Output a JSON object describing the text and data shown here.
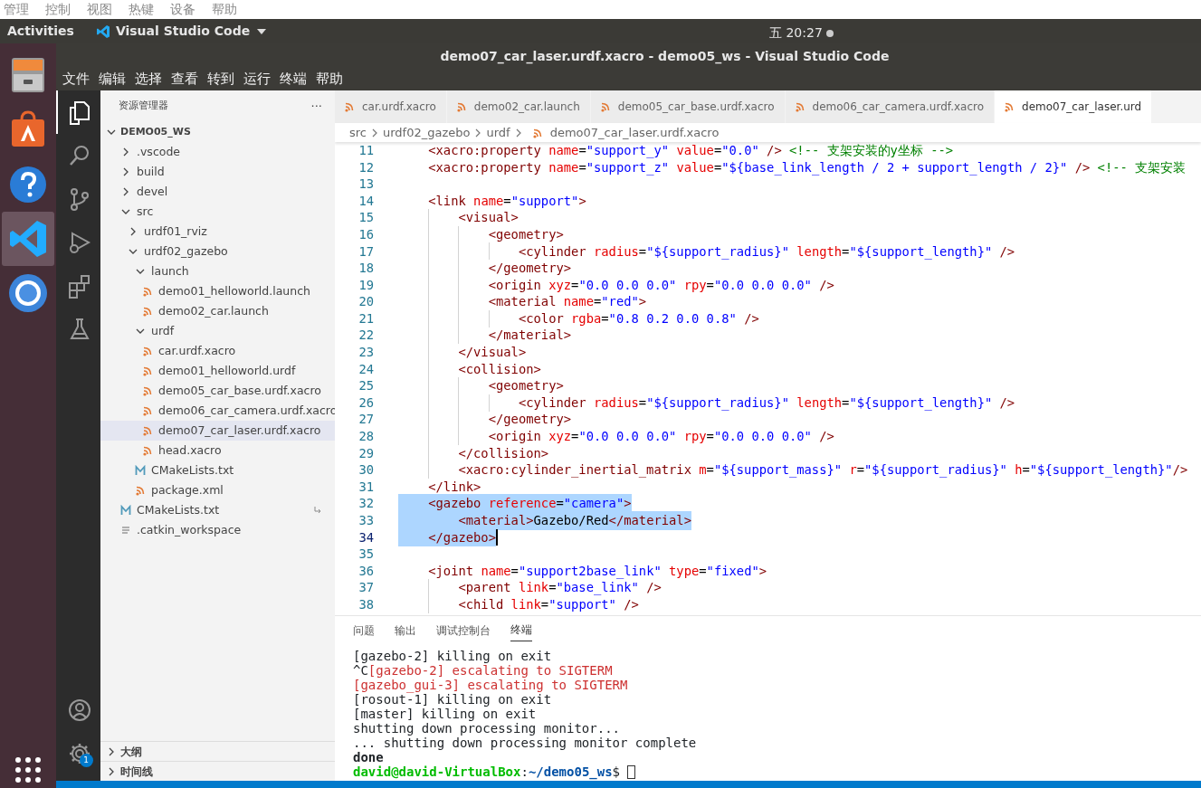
{
  "vm_menu": [
    "管理",
    "控制",
    "视图",
    "热键",
    "设备",
    "帮助"
  ],
  "top_bar": {
    "activities": "Activities",
    "app": "Visual Studio Code",
    "clock": "五 20:27"
  },
  "dock": [
    {
      "kind": "files",
      "selected": false
    },
    {
      "kind": "store",
      "selected": false
    },
    {
      "kind": "help",
      "selected": false
    },
    {
      "kind": "vscode",
      "selected": true
    },
    {
      "kind": "browser",
      "selected": false
    }
  ],
  "window": {
    "title": "demo07_car_laser.urdf.xacro - demo05_ws - Visual Studio Code"
  },
  "menu": [
    "文件",
    "编辑",
    "选择",
    "查看",
    "转到",
    "运行",
    "终端",
    "帮助"
  ],
  "activity_bar": [
    {
      "kind": "explorer",
      "selected": true
    },
    {
      "kind": "search",
      "selected": false
    },
    {
      "kind": "scm",
      "selected": false
    },
    {
      "kind": "debug",
      "selected": false
    },
    {
      "kind": "extensions",
      "selected": false
    },
    {
      "kind": "test",
      "selected": false
    }
  ],
  "activity_bottom": {
    "settings_badge": "1"
  },
  "sidebar": {
    "title": "资源管理器",
    "more": "···",
    "workspace": "DEMO05_WS",
    "tree": [
      {
        "label": ".vscode",
        "kind": "folder",
        "expanded": false
      },
      {
        "label": "build",
        "kind": "folder",
        "expanded": false
      },
      {
        "label": "devel",
        "kind": "folder",
        "expanded": false
      },
      {
        "label": "src",
        "kind": "folder",
        "expanded": true,
        "children": [
          {
            "label": "urdf01_rviz",
            "kind": "folder",
            "expanded": false
          },
          {
            "label": "urdf02_gazebo",
            "kind": "folder",
            "expanded": true,
            "children": [
              {
                "label": "launch",
                "kind": "folder",
                "expanded": true,
                "children": [
                  {
                    "label": "demo01_helloworld.launch",
                    "kind": "xml",
                    "selected": false
                  },
                  {
                    "label": "demo02_car.launch",
                    "kind": "xml",
                    "selected": false
                  }
                ]
              },
              {
                "label": "urdf",
                "kind": "folder",
                "expanded": true,
                "children": [
                  {
                    "label": "car.urdf.xacro",
                    "kind": "xml",
                    "selected": false
                  },
                  {
                    "label": "demo01_helloworld.urdf",
                    "kind": "xml",
                    "selected": false
                  },
                  {
                    "label": "demo05_car_base.urdf.xacro",
                    "kind": "xml",
                    "selected": false
                  },
                  {
                    "label": "demo06_car_camera.urdf.xacro",
                    "kind": "xml",
                    "selected": false
                  },
                  {
                    "label": "demo07_car_laser.urdf.xacro",
                    "kind": "xml",
                    "selected": true
                  },
                  {
                    "label": "head.xacro",
                    "kind": "xml",
                    "selected": false
                  }
                ]
              },
              {
                "label": "CMakeLists.txt",
                "kind": "cmake",
                "selected": false
              },
              {
                "label": "package.xml",
                "kind": "xml",
                "selected": false
              }
            ]
          }
        ]
      },
      {
        "label": "CMakeLists.txt",
        "kind": "cmake",
        "selected": false,
        "symlink": true
      },
      {
        "label": ".catkin_workspace",
        "kind": "file",
        "selected": false
      }
    ],
    "sections": [
      {
        "label": "大纲",
        "expanded": false
      },
      {
        "label": "时间线",
        "expanded": false
      }
    ]
  },
  "tabs": [
    {
      "label": "car.urdf.xacro",
      "selected": false
    },
    {
      "label": "demo02_car.launch",
      "selected": false
    },
    {
      "label": "demo05_car_base.urdf.xacro",
      "selected": false
    },
    {
      "label": "demo06_car_camera.urdf.xacro",
      "selected": false
    },
    {
      "label": "demo07_car_laser.urd",
      "selected": true
    }
  ],
  "breadcrumb": [
    "src",
    "urdf02_gazebo",
    "urdf",
    "demo07_car_laser.urdf.xacro"
  ],
  "code": [
    {
      "number": "11",
      "selected": false,
      "tokens": [
        {
          "kind": "tag",
          "text": "    <xacro:property "
        },
        {
          "kind": "attr",
          "text": "name"
        },
        {
          "kind": "plain",
          "text": "="
        },
        {
          "kind": "string",
          "text": "\"support_y\" "
        },
        {
          "kind": "attr",
          "text": "value"
        },
        {
          "kind": "plain",
          "text": "="
        },
        {
          "kind": "string",
          "text": "\"0.0\""
        },
        {
          "kind": "tag",
          "text": " /> "
        },
        {
          "kind": "comment",
          "text": "<!-- 支架安装的y坐标 -->"
        }
      ]
    },
    {
      "number": "12",
      "selected": false,
      "tokens": [
        {
          "kind": "tag",
          "text": "    <xacro:property "
        },
        {
          "kind": "attr",
          "text": "name"
        },
        {
          "kind": "plain",
          "text": "="
        },
        {
          "kind": "string",
          "text": "\"support_z\" "
        },
        {
          "kind": "attr",
          "text": "value"
        },
        {
          "kind": "plain",
          "text": "="
        },
        {
          "kind": "string",
          "text": "\"${base_link_length / 2 + support_length / 2}\""
        },
        {
          "kind": "tag",
          "text": " /> "
        },
        {
          "kind": "comment",
          "text": "<!-- 支架安装"
        }
      ]
    },
    {
      "number": "13"
    },
    {
      "number": "14",
      "selected": false,
      "tokens": [
        {
          "kind": "tag",
          "text": "    <link "
        },
        {
          "kind": "attr",
          "text": "name"
        },
        {
          "kind": "plain",
          "text": "="
        },
        {
          "kind": "string",
          "text": "\"support\""
        },
        {
          "kind": "tag",
          "text": ">"
        }
      ]
    },
    {
      "number": "15",
      "selected": false,
      "tokens": [
        {
          "kind": "tag",
          "text": "        <visual>"
        }
      ]
    },
    {
      "number": "16",
      "selected": false,
      "tokens": [
        {
          "kind": "tag",
          "text": "            <geometry>"
        }
      ]
    },
    {
      "number": "17",
      "selected": false,
      "tokens": [
        {
          "kind": "tag",
          "text": "                <cylinder "
        },
        {
          "kind": "attr",
          "text": "radius"
        },
        {
          "kind": "plain",
          "text": "="
        },
        {
          "kind": "string",
          "text": "\"${support_radius}\" "
        },
        {
          "kind": "attr",
          "text": "length"
        },
        {
          "kind": "plain",
          "text": "="
        },
        {
          "kind": "string",
          "text": "\"${support_length}\""
        },
        {
          "kind": "tag",
          "text": " />"
        }
      ]
    },
    {
      "number": "18",
      "selected": false,
      "tokens": [
        {
          "kind": "tag",
          "text": "            </geometry>"
        }
      ]
    },
    {
      "number": "19",
      "selected": false,
      "tokens": [
        {
          "kind": "tag",
          "text": "            <origin "
        },
        {
          "kind": "attr",
          "text": "xyz"
        },
        {
          "kind": "plain",
          "text": "="
        },
        {
          "kind": "string",
          "text": "\"0.0 0.0 0.0\" "
        },
        {
          "kind": "attr",
          "text": "rpy"
        },
        {
          "kind": "plain",
          "text": "="
        },
        {
          "kind": "string",
          "text": "\"0.0 0.0 0.0\""
        },
        {
          "kind": "tag",
          "text": " />"
        }
      ]
    },
    {
      "number": "20",
      "selected": false,
      "tokens": [
        {
          "kind": "tag",
          "text": "            <material "
        },
        {
          "kind": "attr",
          "text": "name"
        },
        {
          "kind": "plain",
          "text": "="
        },
        {
          "kind": "string",
          "text": "\"red\""
        },
        {
          "kind": "tag",
          "text": ">"
        }
      ]
    },
    {
      "number": "21",
      "selected": false,
      "tokens": [
        {
          "kind": "tag",
          "text": "                <color "
        },
        {
          "kind": "attr",
          "text": "rgba"
        },
        {
          "kind": "plain",
          "text": "="
        },
        {
          "kind": "string",
          "text": "\"0.8 0.2 0.0 0.8\""
        },
        {
          "kind": "tag",
          "text": " />"
        }
      ]
    },
    {
      "number": "22",
      "selected": false,
      "tokens": [
        {
          "kind": "tag",
          "text": "            </material>"
        }
      ]
    },
    {
      "number": "23",
      "selected": false,
      "tokens": [
        {
          "kind": "tag",
          "text": "        </visual>"
        }
      ]
    },
    {
      "number": "24",
      "selected": false,
      "tokens": [
        {
          "kind": "tag",
          "text": "        <collision>"
        }
      ]
    },
    {
      "number": "25",
      "selected": false,
      "tokens": [
        {
          "kind": "tag",
          "text": "            <geometry>"
        }
      ]
    },
    {
      "number": "26",
      "selected": false,
      "tokens": [
        {
          "kind": "tag",
          "text": "                <cylinder "
        },
        {
          "kind": "attr",
          "text": "radius"
        },
        {
          "kind": "plain",
          "text": "="
        },
        {
          "kind": "string",
          "text": "\"${support_radius}\" "
        },
        {
          "kind": "attr",
          "text": "length"
        },
        {
          "kind": "plain",
          "text": "="
        },
        {
          "kind": "string",
          "text": "\"${support_length}\""
        },
        {
          "kind": "tag",
          "text": " />"
        }
      ]
    },
    {
      "number": "27",
      "selected": false,
      "tokens": [
        {
          "kind": "tag",
          "text": "            </geometry>"
        }
      ]
    },
    {
      "number": "28",
      "selected": false,
      "tokens": [
        {
          "kind": "tag",
          "text": "            <origin "
        },
        {
          "kind": "attr",
          "text": "xyz"
        },
        {
          "kind": "plain",
          "text": "="
        },
        {
          "kind": "string",
          "text": "\"0.0 0.0 0.0\" "
        },
        {
          "kind": "attr",
          "text": "rpy"
        },
        {
          "kind": "plain",
          "text": "="
        },
        {
          "kind": "string",
          "text": "\"0.0 0.0 0.0\""
        },
        {
          "kind": "tag",
          "text": " />"
        }
      ]
    },
    {
      "number": "29",
      "selected": false,
      "tokens": [
        {
          "kind": "tag",
          "text": "        </collision>"
        }
      ]
    },
    {
      "number": "30",
      "selected": false,
      "tokens": [
        {
          "kind": "tag",
          "text": "        <xacro:cylinder_inertial_matrix "
        },
        {
          "kind": "attr",
          "text": "m"
        },
        {
          "kind": "plain",
          "text": "="
        },
        {
          "kind": "string",
          "text": "\"${support_mass}\" "
        },
        {
          "kind": "attr",
          "text": "r"
        },
        {
          "kind": "plain",
          "text": "="
        },
        {
          "kind": "string",
          "text": "\"${support_radius}\" "
        },
        {
          "kind": "attr",
          "text": "h"
        },
        {
          "kind": "plain",
          "text": "="
        },
        {
          "kind": "string",
          "text": "\"${support_length}\""
        },
        {
          "kind": "tag",
          "text": "/>"
        }
      ]
    },
    {
      "number": "31",
      "selected": false,
      "tokens": [
        {
          "kind": "tag",
          "text": "    </link>"
        }
      ]
    },
    {
      "number": "32",
      "selected": true,
      "tokens": [
        {
          "kind": "tag",
          "text": "    <gazebo "
        },
        {
          "kind": "attr",
          "text": "reference"
        },
        {
          "kind": "plain",
          "text": "="
        },
        {
          "kind": "string",
          "text": "\"camera\""
        },
        {
          "kind": "tag",
          "text": ">"
        }
      ]
    },
    {
      "number": "33",
      "selected": true,
      "tokens": [
        {
          "kind": "tag",
          "text": "        <material>"
        },
        {
          "kind": "plain",
          "text": "Gazebo/Red"
        },
        {
          "kind": "tag",
          "text": "</material>"
        }
      ]
    },
    {
      "number": "34",
      "selected": true,
      "cursor": true,
      "tokens": [
        {
          "kind": "tag",
          "text": "    </gazebo>"
        }
      ]
    },
    {
      "number": "35"
    },
    {
      "number": "36",
      "selected": false,
      "tokens": [
        {
          "kind": "tag",
          "text": "    <joint "
        },
        {
          "kind": "attr",
          "text": "name"
        },
        {
          "kind": "plain",
          "text": "="
        },
        {
          "kind": "string",
          "text": "\"support2base_link\" "
        },
        {
          "kind": "attr",
          "text": "type"
        },
        {
          "kind": "plain",
          "text": "="
        },
        {
          "kind": "string",
          "text": "\"fixed\""
        },
        {
          "kind": "tag",
          "text": ">"
        }
      ]
    },
    {
      "number": "37",
      "selected": false,
      "tokens": [
        {
          "kind": "tag",
          "text": "        <parent "
        },
        {
          "kind": "attr",
          "text": "link"
        },
        {
          "kind": "plain",
          "text": "="
        },
        {
          "kind": "string",
          "text": "\"base_link\""
        },
        {
          "kind": "tag",
          "text": " />"
        }
      ]
    },
    {
      "number": "38",
      "selected": false,
      "tokens": [
        {
          "kind": "tag",
          "text": "        <child "
        },
        {
          "kind": "attr",
          "text": "link"
        },
        {
          "kind": "plain",
          "text": "="
        },
        {
          "kind": "string",
          "text": "\"support\""
        },
        {
          "kind": "tag",
          "text": " />"
        }
      ]
    }
  ],
  "panel_tabs": [
    {
      "label": "问题",
      "selected": false
    },
    {
      "label": "输出",
      "selected": false
    },
    {
      "label": "调试控制台",
      "selected": false
    },
    {
      "label": "终端",
      "selected": true
    }
  ],
  "terminal": [
    {
      "parts": [
        {
          "kind": "plain",
          "text": "[gazebo-2] killing on exit"
        }
      ]
    },
    {
      "parts": [
        {
          "kind": "plain",
          "text": "^C"
        },
        {
          "kind": "error",
          "text": "[gazebo-2] escalating to SIGTERM"
        }
      ]
    },
    {
      "parts": [
        {
          "kind": "error",
          "text": "[gazebo_gui-3] escalating to SIGTERM"
        }
      ]
    },
    {
      "parts": [
        {
          "kind": "plain",
          "text": "[rosout-1] killing on exit"
        }
      ]
    },
    {
      "parts": [
        {
          "kind": "plain",
          "text": "[master] killing on exit"
        }
      ]
    },
    {
      "parts": [
        {
          "kind": "plain",
          "text": "shutting down processing monitor..."
        }
      ]
    },
    {
      "parts": [
        {
          "kind": "plain",
          "text": "... shutting down processing monitor complete"
        }
      ]
    },
    {
      "parts": [
        {
          "kind": "bold",
          "text": "done"
        }
      ]
    },
    {
      "parts": [
        {
          "kind": "user",
          "text": "david@david-VirtualBox"
        },
        {
          "kind": "plain",
          "text": ":"
        },
        {
          "kind": "path",
          "text": "~/demo05_ws"
        },
        {
          "kind": "plain",
          "text": "$"
        }
      ],
      "cursor": true
    }
  ]
}
